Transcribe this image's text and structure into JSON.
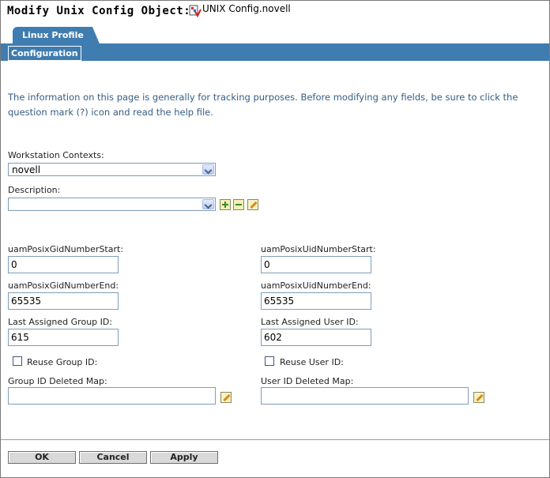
{
  "header": {
    "title": "Modify Unix Config Object:",
    "object_name": "UNIX Config.novell",
    "object_icon": "unix-config-icon"
  },
  "tabs": [
    {
      "label": "Linux Profile"
    }
  ],
  "subtabs": [
    {
      "label": "Configuration"
    }
  ],
  "info_text": "The information on this page is generally for tracking purposes. Before modifying any fields, be sure to click the question mark (?) icon and read the help file.",
  "form": {
    "workstation_contexts": {
      "label": "Workstation Contexts:",
      "value": "novell"
    },
    "description": {
      "label": "Description:",
      "value": ""
    },
    "gid_start": {
      "label": "uamPosixGidNumberStart:",
      "value": "0"
    },
    "uid_start": {
      "label": "uamPosixUidNumberStart:",
      "value": "0"
    },
    "gid_end": {
      "label": "uamPosixGidNumberEnd:",
      "value": "65535"
    },
    "uid_end": {
      "label": "uamPosixUidNumberEnd:",
      "value": "65535"
    },
    "last_group": {
      "label": "Last Assigned Group ID:",
      "value": "615"
    },
    "last_user": {
      "label": "Last Assigned User ID:",
      "value": "602"
    },
    "reuse_group": {
      "label": "Reuse Group ID:",
      "checked": false
    },
    "reuse_user": {
      "label": "Reuse User ID:",
      "checked": false
    },
    "group_deleted_map": {
      "label": "Group ID Deleted Map:",
      "value": ""
    },
    "user_deleted_map": {
      "label": "User ID Deleted Map:",
      "value": ""
    }
  },
  "buttons": {
    "ok": "OK",
    "cancel": "Cancel",
    "apply": "Apply"
  },
  "colors": {
    "accent": "#3f7cb0",
    "info_text": "#355d84"
  }
}
